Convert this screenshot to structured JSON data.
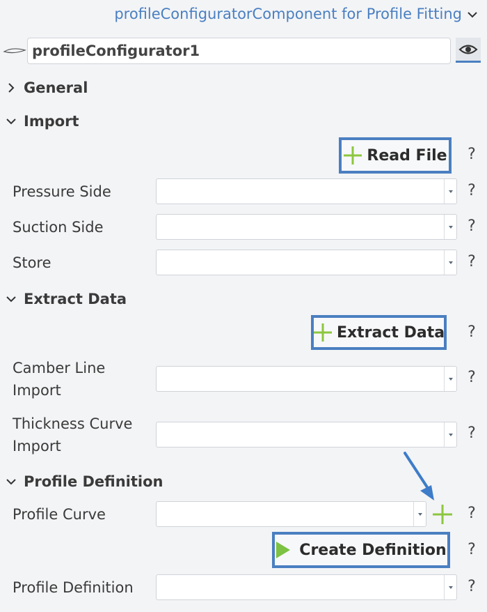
{
  "header": {
    "title": "profileConfiguratorComponent for Profile Fitting"
  },
  "name_field": {
    "value": "profileConfigurator1"
  },
  "sections": {
    "general": "General",
    "import": "Import",
    "extract_data": "Extract Data",
    "profile_definition": "Profile Definition"
  },
  "import": {
    "read_file_label": "Read File",
    "pressure_side_label": "Pressure Side",
    "suction_side_label": "Suction Side",
    "store_label": "Store"
  },
  "extract": {
    "extract_button_label": "Extract Data",
    "camber_line_label_1": "Camber Line",
    "camber_line_label_2": "Import",
    "thickness_label_1": "Thickness Curve",
    "thickness_label_2": "Import"
  },
  "profile": {
    "profile_curve_label": "Profile Curve",
    "create_button_label": "Create Definition",
    "profile_definition_label": "Profile Definition"
  },
  "help_text": "?",
  "colors": {
    "accent": "#4a7fc1",
    "plus_green": "#8cc63f",
    "play_green": "#7dc242",
    "annotation_arrow": "#3d7cc9"
  }
}
